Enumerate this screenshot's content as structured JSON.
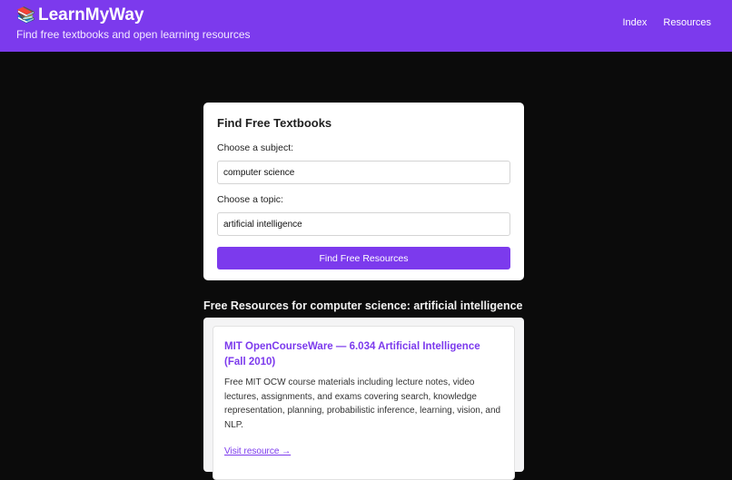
{
  "header": {
    "icon": "books-icon",
    "brand": "LearnMyWay",
    "tagline": "Find free textbooks and open learning resources",
    "nav": [
      "Index",
      "Resources"
    ],
    "color": "#7c3aed"
  },
  "search": {
    "title": "Find Free Textbooks",
    "subject_label": "Choose a subject:",
    "subject_value": "computer science",
    "topic_label": "Choose a topic:",
    "topic_value": "artificial intelligence",
    "button_label": "Find Free Resources"
  },
  "results": {
    "heading": "Free Resources for computer science: artificial intelligence",
    "items": [
      {
        "title": "MIT OpenCourseWare — 6.034 Artificial Intelligence (Fall 2010)",
        "description": "Free MIT OCW course materials including lecture notes, video lectures, assignments, and exams covering search, knowledge representation, planning, probabilistic inference, learning, vision, and NLP.",
        "link": "Visit resource →"
      }
    ]
  }
}
